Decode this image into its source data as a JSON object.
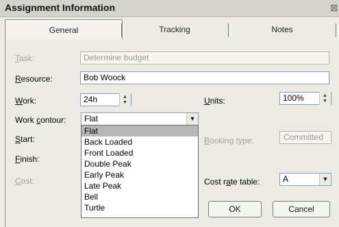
{
  "window": {
    "title": "Assignment Information",
    "close_label": "⊠"
  },
  "tabs": [
    {
      "label": "General"
    },
    {
      "label": "Tracking"
    },
    {
      "label": "Notes"
    }
  ],
  "fields": {
    "task": {
      "label_key": "T",
      "label_rest": "ask:",
      "value": "Determine budget"
    },
    "resource": {
      "label_key": "R",
      "label_rest": "esource:",
      "value": "Bob Woock"
    },
    "work": {
      "label_key": "W",
      "label_rest": "ork:",
      "value": "24h"
    },
    "units": {
      "label_key": "U",
      "label_rest": "nits:",
      "value": "100%"
    },
    "work_contour": {
      "label_pre": "Work ",
      "label_key": "c",
      "label_rest": "ontour:",
      "value": "Flat"
    },
    "start": {
      "label_key": "S",
      "label_rest": "tart:"
    },
    "finish": {
      "label_key": "F",
      "label_rest": "inish:"
    },
    "cost": {
      "label_key": "C",
      "label_rest": "ost:"
    },
    "booking_type": {
      "label_key": "B",
      "label_rest": "ooking type:",
      "value": "Committed"
    },
    "cost_rate_table": {
      "label_pre": "Cost r",
      "label_key": "a",
      "label_rest": "te table:",
      "value": "A"
    }
  },
  "contour_options": [
    "Flat",
    "Back Loaded",
    "Front Loaded",
    "Double Peak",
    "Early Peak",
    "Late Peak",
    "Bell",
    "Turtle"
  ],
  "buttons": {
    "ok": "OK",
    "cancel": "Cancel"
  },
  "icons": {
    "spin_up": "▲",
    "spin_down": "▼",
    "dropdown": "▼"
  }
}
